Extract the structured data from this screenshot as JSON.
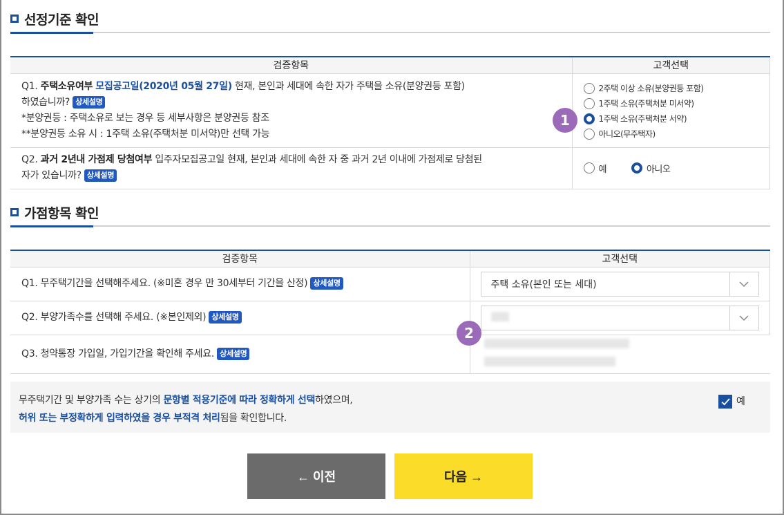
{
  "section1": {
    "title": "선정기준 확인"
  },
  "table1": {
    "col1": "검증항목",
    "col2": "고객선택",
    "q1": {
      "num": "Q1.",
      "lead": "주택소유여부",
      "hl1": "모집공고일",
      "hl2": "(2020년 05월 27일)",
      "rest1": " 현재, 본인과 세대에 속한 자가 주택을 소유(분양권등 포함)",
      "rest2": "하였습니까?",
      "badge": "상세설명",
      "note1": "*분양권등 : 주택소유로 보는 경우 등 세부사항은 분양권등 참조",
      "note2": "**분양권등 소유 시 : 1주택 소유(주택처분 미서약)만 선택 가능",
      "options": [
        "2주택 이상 소유(분양권등 포함)",
        "1주택 소유(주택처분 미서약)",
        "1주택 소유(주택처분 서약)",
        "아니오(무주택자)"
      ],
      "selected_index": 2
    },
    "q2": {
      "num": "Q2.",
      "lead": "과거 2년내 가점제 당첨여부",
      "rest1": " 입주자모집공고일 현재, 본인과 세대에 속한 자 중 과거 2년 이내에 가점제로 당첨된",
      "rest2": "자가 있습니까?",
      "badge": "상세설명",
      "opt_yes": "예",
      "opt_no": "아니오"
    }
  },
  "section2": {
    "title": "가점항목 확인"
  },
  "table2": {
    "col1": "검증항목",
    "col2": "고객선택",
    "q1": {
      "text": "Q1. 무주택기간을 선택해주세요. (※미혼 경우 만 30세부터 기간을 산정)",
      "badge": "상세설명",
      "select_value": "주택 소유(본인 또는 세대)"
    },
    "q2": {
      "text": "Q2. 부양가족수를 선택해 주세요. (※본인제외)",
      "badge": "상세설명"
    },
    "q3": {
      "text": "Q3. 청약통장 가입일, 가입기간을 확인해 주세요.",
      "badge": "상세설명"
    }
  },
  "markers": {
    "m1": "1",
    "m2": "2"
  },
  "agree": {
    "l1a": "무주택기간 및 부양가족 수는 상기의 ",
    "l1b": "문항별 적용기준에 따라 정확하게 선택",
    "l1c": "하였으며,",
    "l2a": "허위 또는 부정확하게 입력하였을 경우 부적격 처리",
    "l2b": "됨을 확인합니다.",
    "check_label": "예"
  },
  "buttons": {
    "prev": "← 이전",
    "next": "다음 →"
  },
  "colors": {
    "accent": "#1a4fa0",
    "badge": "#2259c0",
    "marker": "#9b6ab8",
    "next": "#fbdc28",
    "prev": "#6b6b6b"
  }
}
